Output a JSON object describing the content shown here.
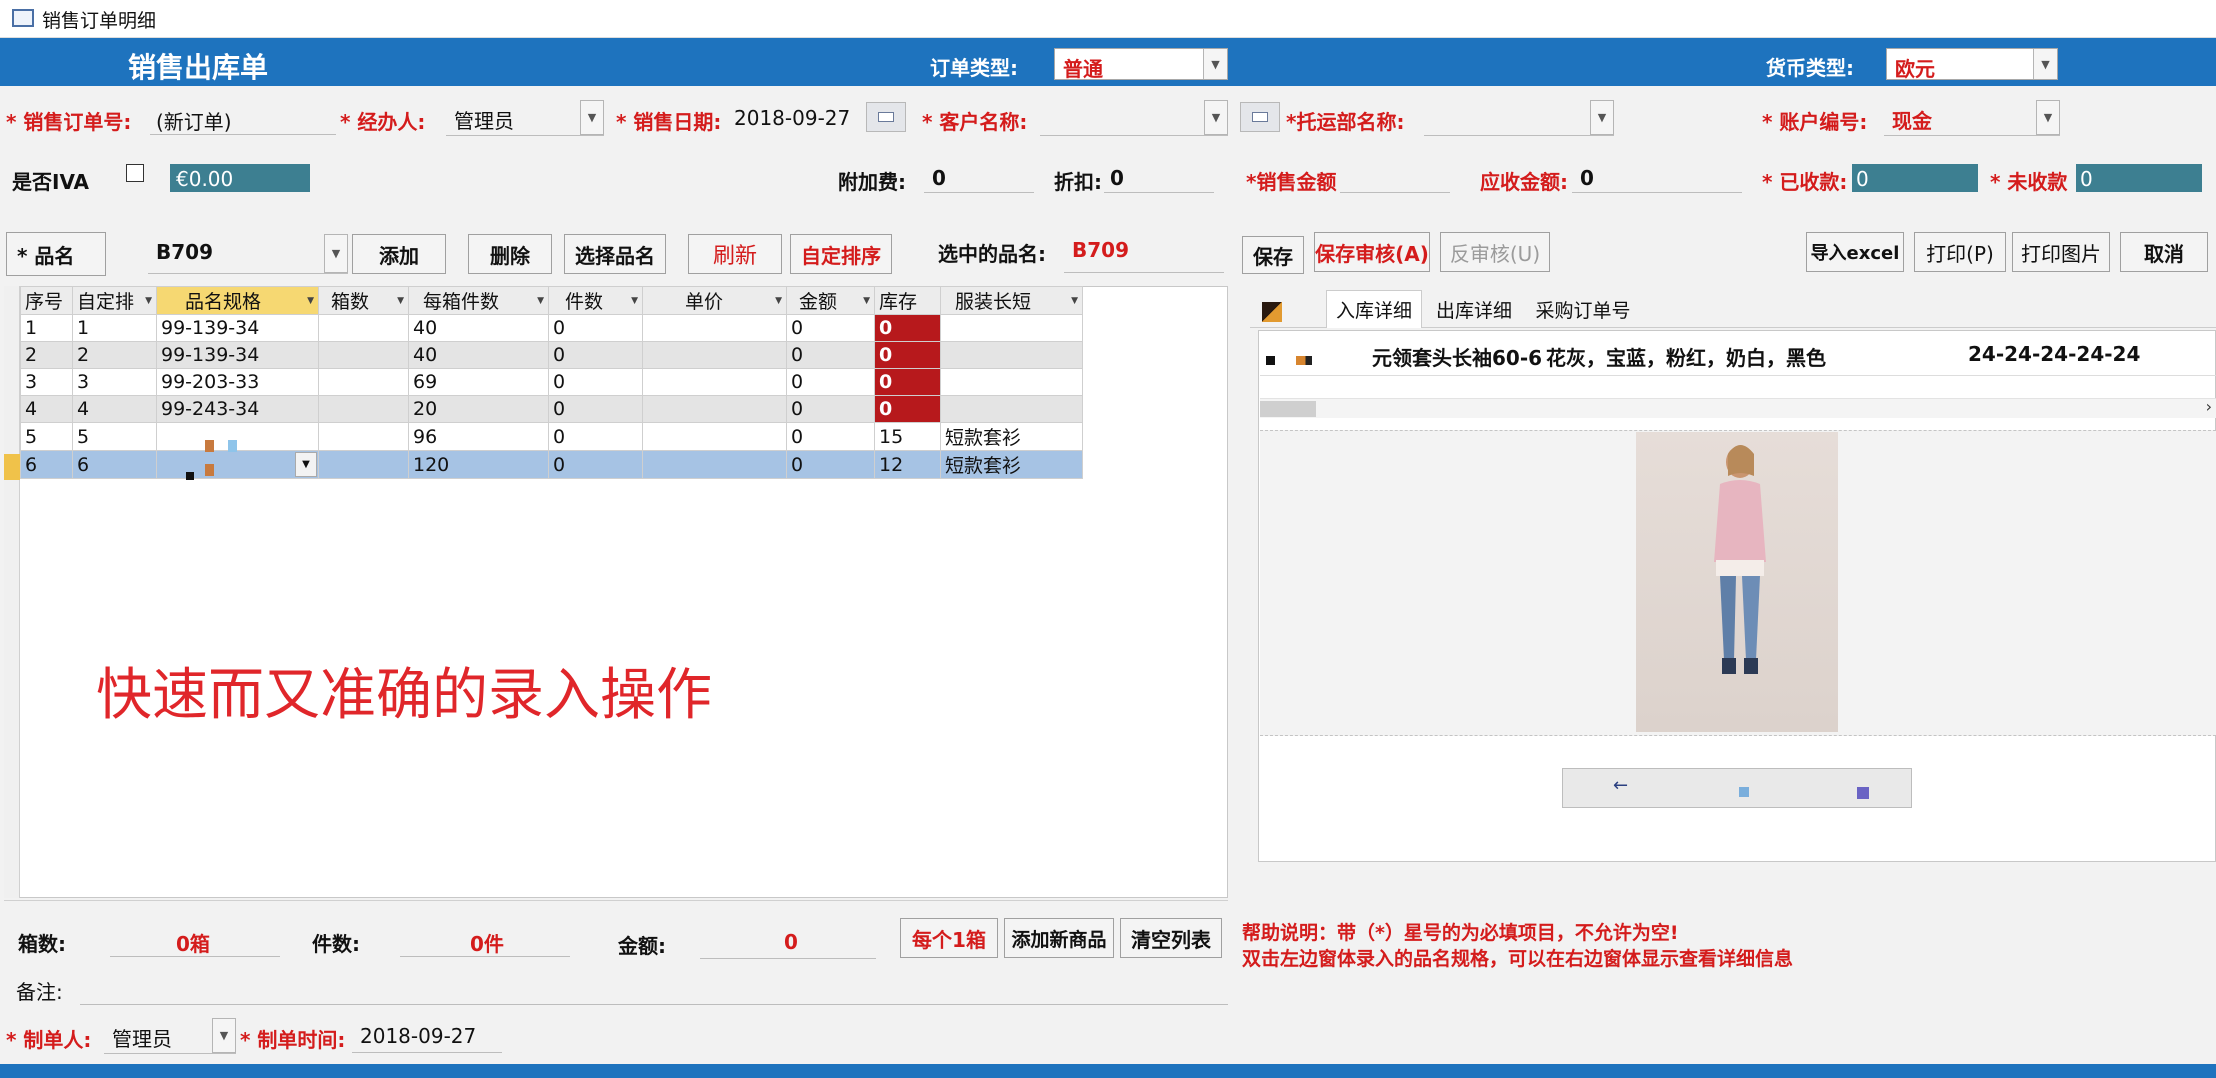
{
  "window": {
    "title": "销售订单明细"
  },
  "header": {
    "title": "销售出库单",
    "order_type_label": "订单类型:",
    "order_type_value": "普通",
    "currency_label": "货币类型:",
    "currency_value": "欧元"
  },
  "fields": {
    "order_no_label": "* 销售订单号:",
    "order_no_value": "(新订单)",
    "handler_label": "* 经办人:",
    "handler_value": "管理员",
    "sale_date_label": "* 销售日期:",
    "sale_date_value": "2018-09-27",
    "customer_label": "* 客户名称:",
    "shipping_label": "*托运部名称:",
    "account_label": "* 账户编号:",
    "account_value": "现金",
    "iva_label": "是否IVA",
    "iva_value": "€0.00",
    "surcharge_label": "附加费:",
    "surcharge_value": "0",
    "discount_label": "折扣:",
    "discount_value": "0",
    "sales_amount_label": "*销售金额",
    "receivable_label": "应收金额:",
    "receivable_value": "0",
    "received_label": "* 已收款:",
    "received_value": "0",
    "unreceived_label": "* 未收款",
    "unreceived_value": "0"
  },
  "product_bar": {
    "label": "* 品名",
    "value": "B709",
    "add": "添加",
    "delete": "删除",
    "select": "选择品名",
    "refresh": "刷新",
    "custom_sort": "自定排序",
    "selected_label": "选中的品名:",
    "selected_value": "B709"
  },
  "right_toolbar": {
    "save": "保存",
    "save_audit": "保存审核(A)",
    "unaudit": "反审核(U)",
    "import_excel": "导入excel",
    "print": "打印(P)",
    "print_image": "打印图片",
    "cancel": "取消"
  },
  "grid": {
    "headers": [
      "序号",
      "自定排",
      "品名规格",
      "箱数",
      "每箱件数",
      "件数",
      "单价",
      "金额",
      "库存",
      "服装长短"
    ],
    "rows": [
      {
        "seq": "1",
        "custom": "1",
        "spec": "99-139-34",
        "boxes": "",
        "per_box": "40",
        "qty": "0",
        "price": "",
        "amount": "0",
        "stock": "0",
        "length": ""
      },
      {
        "seq": "2",
        "custom": "2",
        "spec": "99-139-34",
        "boxes": "",
        "per_box": "40",
        "qty": "0",
        "price": "",
        "amount": "0",
        "stock": "0",
        "length": ""
      },
      {
        "seq": "3",
        "custom": "3",
        "spec": "99-203-33",
        "boxes": "",
        "per_box": "69",
        "qty": "0",
        "price": "",
        "amount": "0",
        "stock": "0",
        "length": ""
      },
      {
        "seq": "4",
        "custom": "4",
        "spec": "99-243-34",
        "boxes": "",
        "per_box": "20",
        "qty": "0",
        "price": "",
        "amount": "0",
        "stock": "0",
        "length": ""
      },
      {
        "seq": "5",
        "custom": "5",
        "spec": "",
        "boxes": "",
        "per_box": "96",
        "qty": "0",
        "price": "",
        "amount": "0",
        "stock": "15",
        "length": "短款套衫"
      },
      {
        "seq": "6",
        "custom": "6",
        "spec": "",
        "boxes": "",
        "per_box": "120",
        "qty": "0",
        "price": "",
        "amount": "0",
        "stock": "12",
        "length": "短款套衫"
      }
    ]
  },
  "promo_text": "快速而又准确的录入操作",
  "right_tabs": [
    "入库详细",
    "出库详细",
    "采购订单号"
  ],
  "detail_row": {
    "desc": "元领套头长袖60-6",
    "colors": "花灰，宝蓝，粉红，奶白，黑色",
    "sizes": "24-24-24-24-24"
  },
  "footer": {
    "boxes_label": "箱数:",
    "boxes_value": "0箱",
    "pieces_label": "件数:",
    "pieces_value": "0件",
    "amount_label": "金额:",
    "amount_value": "0",
    "per_box_btn": "每个1箱",
    "add_product_btn": "添加新商品",
    "clear_btn": "清空列表",
    "remark_label": "备注:",
    "maker_label": "* 制单人:",
    "maker_value": "管理员",
    "make_time_label": "* 制单时间:",
    "make_time_value": "2018-09-27"
  },
  "help": {
    "line1": "帮助说明：带（*）星号的为必填项目，不允许为空!",
    "line2": "双击左边窗体录入的品名规格，可以在右边窗体显示查看详细信息"
  },
  "colors": {
    "header_blue": "#1e73be",
    "label_red": "#d41c1c",
    "stock_red": "#b7191c",
    "teal_field": "#3d7f91",
    "selected_row": "#a6c3e4"
  }
}
